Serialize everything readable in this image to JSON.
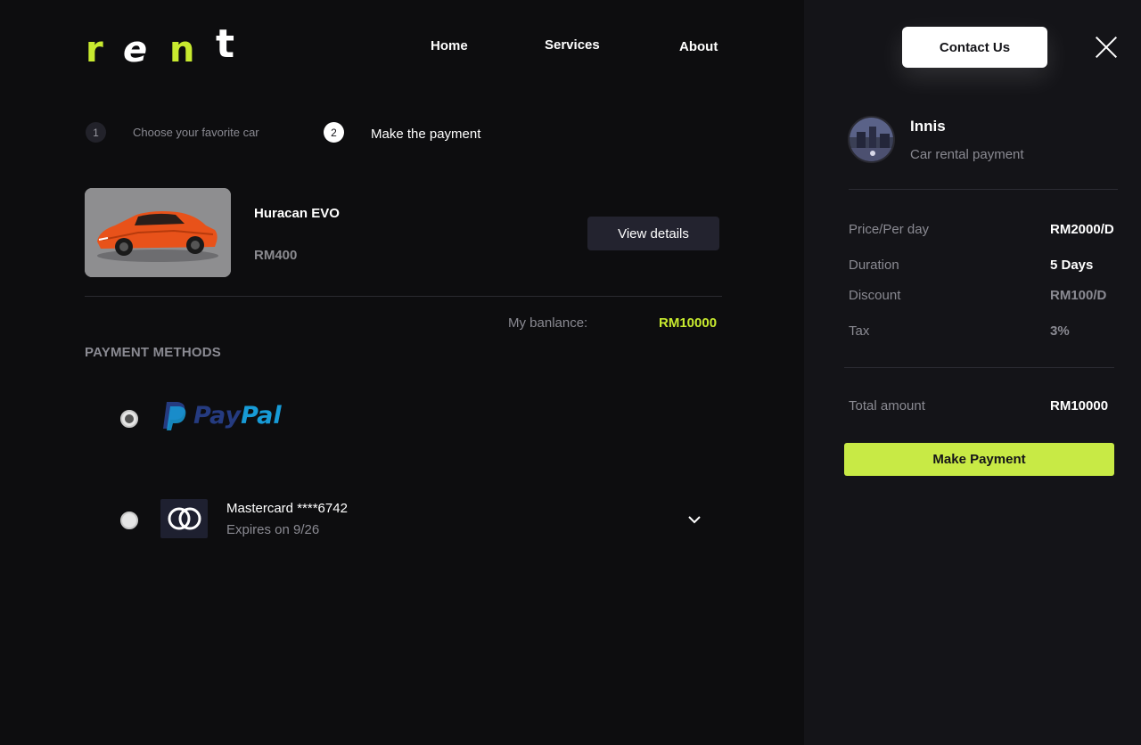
{
  "brand": {
    "letters": [
      "r",
      "e",
      "n",
      "t"
    ],
    "accent_color": "#c8ea2f"
  },
  "nav": {
    "home": "Home",
    "services": "Services",
    "about": "About",
    "contact": "Contact Us"
  },
  "steps": [
    {
      "number": "1",
      "label": "Choose your favorite car",
      "state": "done"
    },
    {
      "number": "2",
      "label": "Make the payment",
      "state": "active"
    }
  ],
  "car": {
    "name": "Huracan EVO",
    "price": "RM400",
    "view_details_label": "View details",
    "body_color": "#e8521a"
  },
  "balance": {
    "label": "My banlance:",
    "value": "RM10000"
  },
  "payment_methods": {
    "title": "PAYMENT METHODS",
    "paypal": {
      "pay": "Pay",
      "pal": "Pal",
      "selected": true
    },
    "mastercard": {
      "name": "Mastercard ****6742",
      "expires": "Expires on 9/26",
      "selected": false
    }
  },
  "summary": {
    "user_name": "Innis",
    "user_subtitle": "Car rental payment",
    "rows": [
      {
        "label": "Price/Per day",
        "value": "RM2000/D"
      },
      {
        "label": "Duration",
        "value": "5 Days"
      },
      {
        "label": "Discount",
        "value": "RM100/D"
      },
      {
        "label": "Tax",
        "value": "3%"
      }
    ],
    "total_label": "Total amount",
    "total_value": "RM10000",
    "pay_button": "Make Payment",
    "pay_button_color": "#c8ea45"
  },
  "icons": [
    "close-icon",
    "chevron-down-icon",
    "paypal-logo",
    "mastercard-icon"
  ]
}
